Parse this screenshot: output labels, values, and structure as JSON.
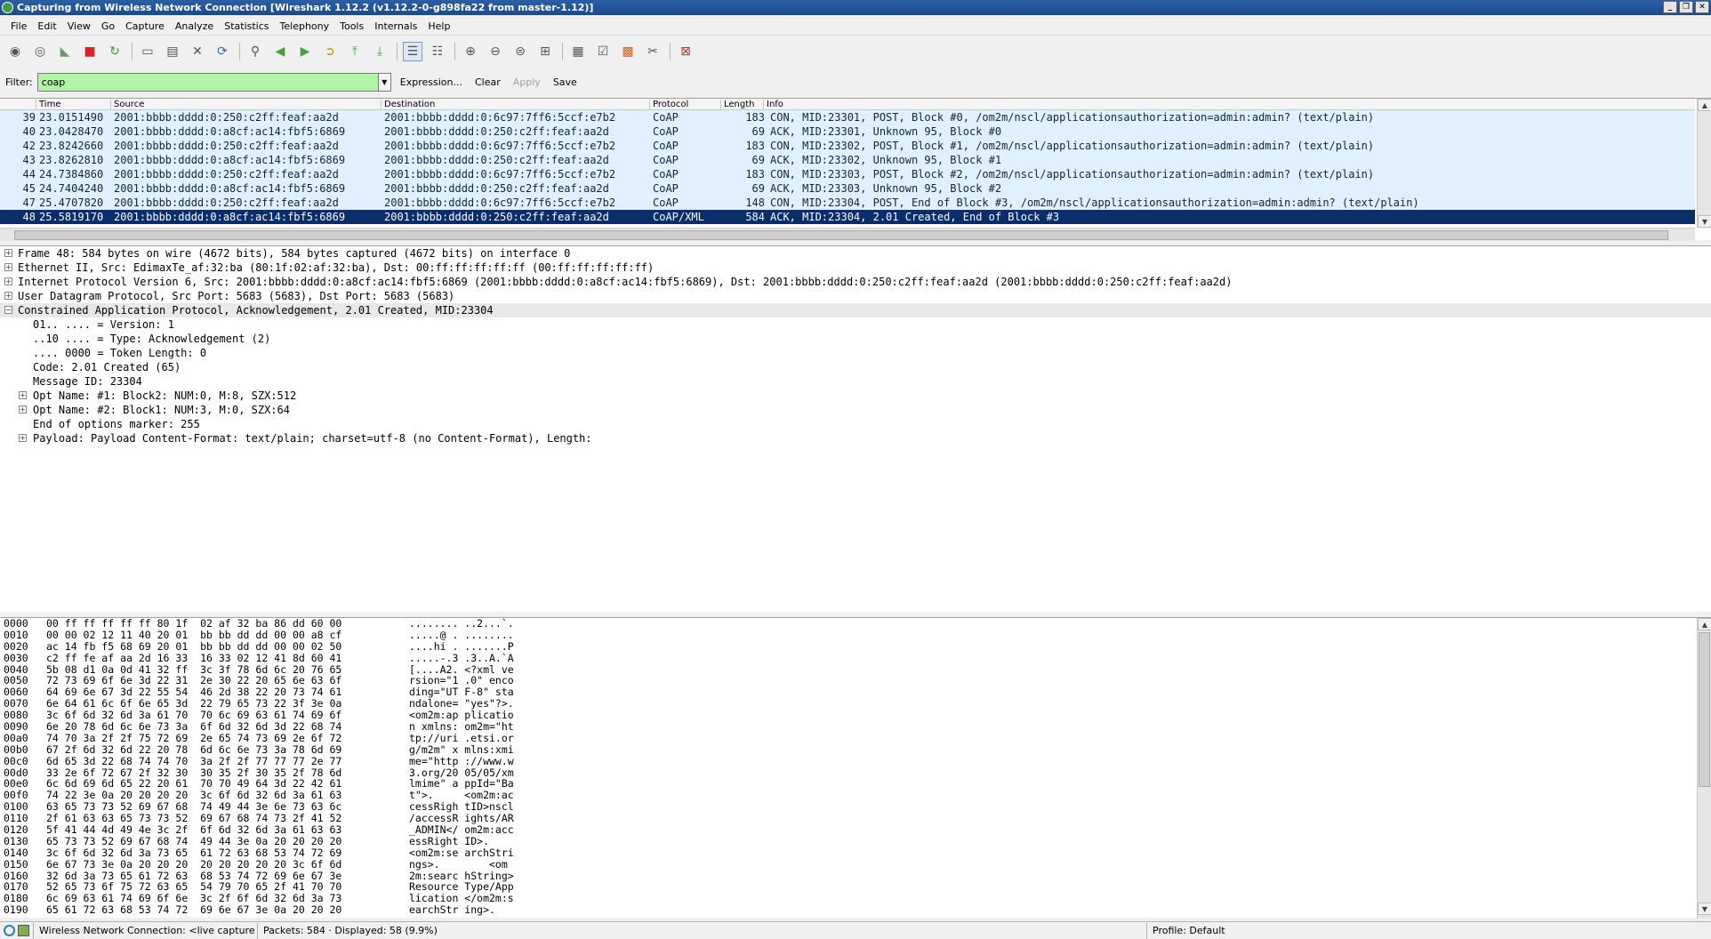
{
  "window": {
    "title": "Capturing from Wireless Network Connection   [Wireshark 1.12.2  (v1.12.2-0-g898fa22 from master-1.12)]",
    "buttons": [
      "_",
      "❐",
      "✕"
    ]
  },
  "menu": [
    "File",
    "Edit",
    "View",
    "Go",
    "Capture",
    "Analyze",
    "Statistics",
    "Telephony",
    "Tools",
    "Internals",
    "Help"
  ],
  "filter": {
    "label": "Filter:",
    "value": "coap",
    "expression": "Expression...",
    "clear": "Clear",
    "apply": "Apply",
    "save": "Save"
  },
  "packet_list": {
    "columns": [
      "Time",
      "Source",
      "Destination",
      "Protocol",
      "Length",
      "Info"
    ],
    "rows": [
      {
        "no": "39",
        "time": "23.0151490",
        "src": "2001:bbbb:dddd:0:250:c2ff:feaf:aa2d",
        "dst": "2001:bbbb:dddd:0:6c97:7ff6:5ccf:e7b2",
        "proto": "CoAP",
        "len": "183",
        "info": "CON, MID:23301, POST, Block #0, /om2m/nscl/applicationsauthorization=admin:admin? (text/plain)"
      },
      {
        "no": "40",
        "time": "23.0428470",
        "src": "2001:bbbb:dddd:0:a8cf:ac14:fbf5:6869",
        "dst": "2001:bbbb:dddd:0:250:c2ff:feaf:aa2d",
        "proto": "CoAP",
        "len": "69",
        "info": "ACK, MID:23301, Unknown 95, Block #0"
      },
      {
        "no": "42",
        "time": "23.8242660",
        "src": "2001:bbbb:dddd:0:250:c2ff:feaf:aa2d",
        "dst": "2001:bbbb:dddd:0:6c97:7ff6:5ccf:e7b2",
        "proto": "CoAP",
        "len": "183",
        "info": "CON, MID:23302, POST, Block #1, /om2m/nscl/applicationsauthorization=admin:admin? (text/plain)"
      },
      {
        "no": "43",
        "time": "23.8262810",
        "src": "2001:bbbb:dddd:0:a8cf:ac14:fbf5:6869",
        "dst": "2001:bbbb:dddd:0:250:c2ff:feaf:aa2d",
        "proto": "CoAP",
        "len": "69",
        "info": "ACK, MID:23302, Unknown 95, Block #1"
      },
      {
        "no": "44",
        "time": "24.7384860",
        "src": "2001:bbbb:dddd:0:250:c2ff:feaf:aa2d",
        "dst": "2001:bbbb:dddd:0:6c97:7ff6:5ccf:e7b2",
        "proto": "CoAP",
        "len": "183",
        "info": "CON, MID:23303, POST, Block #2, /om2m/nscl/applicationsauthorization=admin:admin? (text/plain)"
      },
      {
        "no": "45",
        "time": "24.7404240",
        "src": "2001:bbbb:dddd:0:a8cf:ac14:fbf5:6869",
        "dst": "2001:bbbb:dddd:0:250:c2ff:feaf:aa2d",
        "proto": "CoAP",
        "len": "69",
        "info": "ACK, MID:23303, Unknown 95, Block #2"
      },
      {
        "no": "47",
        "time": "25.4707820",
        "src": "2001:bbbb:dddd:0:250:c2ff:feaf:aa2d",
        "dst": "2001:bbbb:dddd:0:6c97:7ff6:5ccf:e7b2",
        "proto": "CoAP",
        "len": "148",
        "info": "CON, MID:23304, POST, End of Block #3, /om2m/nscl/applicationsauthorization=admin:admin? (text/plain)"
      },
      {
        "no": "48",
        "time": "25.5819170",
        "src": "2001:bbbb:dddd:0:a8cf:ac14:fbf5:6869",
        "dst": "2001:bbbb:dddd:0:250:c2ff:feaf:aa2d",
        "proto": "CoAP/XML",
        "len": "584",
        "info": "ACK, MID:23304, 2.01 Created, End of Block #3"
      }
    ]
  },
  "details": [
    {
      "text": "Frame 48: 584 bytes on wire (4672 bits), 584 bytes captured (4672 bits) on interface 0",
      "exp": "+"
    },
    {
      "text": "Ethernet II, Src: EdimaxTe_af:32:ba (80:1f:02:af:32:ba), Dst: 00:ff:ff:ff:ff:ff (00:ff:ff:ff:ff:ff)",
      "exp": "+"
    },
    {
      "text": "Internet Protocol Version 6, Src: 2001:bbbb:dddd:0:a8cf:ac14:fbf5:6869 (2001:bbbb:dddd:0:a8cf:ac14:fbf5:6869), Dst: 2001:bbbb:dddd:0:250:c2ff:feaf:aa2d (2001:bbbb:dddd:0:250:c2ff:feaf:aa2d)",
      "exp": "+"
    },
    {
      "text": "User Datagram Protocol, Src Port: 5683 (5683), Dst Port: 5683 (5683)",
      "exp": "+"
    },
    {
      "text": "Constrained Application Protocol, Acknowledgement, 2.01 Created, MID:23304",
      "exp": "−"
    },
    {
      "text": "01.. .... = Version: 1",
      "exp": ""
    },
    {
      "text": "..10 .... = Type: Acknowledgement (2)",
      "exp": ""
    },
    {
      "text": ".... 0000 = Token Length: 0",
      "exp": ""
    },
    {
      "text": "Code: 2.01 Created (65)",
      "exp": ""
    },
    {
      "text": "Message ID: 23304",
      "exp": ""
    },
    {
      "text": "Opt Name: #1: Block2: NUM:0, M:8, SZX:512",
      "exp": "+"
    },
    {
      "text": "Opt Name: #2: Block1: NUM:3, M:0, SZX:64",
      "exp": "+"
    },
    {
      "text": "End of options marker: 255",
      "exp": ""
    },
    {
      "text": "Payload: Payload Content-Format: text/plain; charset=utf-8 (no Content-Format), Length:",
      "exp": "+"
    }
  ],
  "hex": [
    {
      "off": "0000",
      "bytes": "00 ff ff ff ff ff 80 1f  02 af 32 ba 86 dd 60 00",
      "ascii": "........ ..2...`."
    },
    {
      "off": "0010",
      "bytes": "00 00 02 12 11 40 20 01  bb bb dd dd 00 00 a8 cf",
      "ascii": ".....@ . ........"
    },
    {
      "off": "0020",
      "bytes": "ac 14 fb f5 68 69 20 01  bb bb dd dd 00 00 02 50",
      "ascii": "....hi . .......P"
    },
    {
      "off": "0030",
      "bytes": "c2 ff fe af aa 2d 16 33  16 33 02 12 41 8d 60 41",
      "ascii": ".....-.3 .3..A.`A"
    },
    {
      "off": "0040",
      "bytes": "5b 08 d1 0a 0d 41 32 ff  3c 3f 78 6d 6c 20 76 65",
      "ascii": "[....A2. <?xml ve"
    },
    {
      "off": "0050",
      "bytes": "72 73 69 6f 6e 3d 22 31  2e 30 22 20 65 6e 63 6f",
      "ascii": "rsion=\"1 .0\" enco"
    },
    {
      "off": "0060",
      "bytes": "64 69 6e 67 3d 22 55 54  46 2d 38 22 20 73 74 61",
      "ascii": "ding=\"UT F-8\" sta"
    },
    {
      "off": "0070",
      "bytes": "6e 64 61 6c 6f 6e 65 3d  22 79 65 73 22 3f 3e 0a",
      "ascii": "ndalone= \"yes\"?>."
    },
    {
      "off": "0080",
      "bytes": "3c 6f 6d 32 6d 3a 61 70  70 6c 69 63 61 74 69 6f",
      "ascii": "<om2m:ap plicatio"
    },
    {
      "off": "0090",
      "bytes": "6e 20 78 6d 6c 6e 73 3a  6f 6d 32 6d 3d 22 68 74",
      "ascii": "n xmlns: om2m=\"ht"
    },
    {
      "off": "00a0",
      "bytes": "74 70 3a 2f 2f 75 72 69  2e 65 74 73 69 2e 6f 72",
      "ascii": "tp://uri .etsi.or"
    },
    {
      "off": "00b0",
      "bytes": "67 2f 6d 32 6d 22 20 78  6d 6c 6e 73 3a 78 6d 69",
      "ascii": "g/m2m\" x mlns:xmi"
    },
    {
      "off": "00c0",
      "bytes": "6d 65 3d 22 68 74 74 70  3a 2f 2f 77 77 77 2e 77",
      "ascii": "me=\"http ://www.w"
    },
    {
      "off": "00d0",
      "bytes": "33 2e 6f 72 67 2f 32 30  30 35 2f 30 35 2f 78 6d",
      "ascii": "3.org/20 05/05/xm"
    },
    {
      "off": "00e0",
      "bytes": "6c 6d 69 6d 65 22 20 61  70 70 49 64 3d 22 42 61",
      "ascii": "lmime\" a ppId=\"Ba"
    },
    {
      "off": "00f0",
      "bytes": "74 22 3e 0a 20 20 20 20  3c 6f 6d 32 6d 3a 61 63",
      "ascii": "t\">.     <om2m:ac"
    },
    {
      "off": "0100",
      "bytes": "63 65 73 73 52 69 67 68  74 49 44 3e 6e 73 63 6c",
      "ascii": "cessRigh tID>nscl"
    },
    {
      "off": "0110",
      "bytes": "2f 61 63 63 65 73 73 52  69 67 68 74 73 2f 41 52",
      "ascii": "/accessR ights/AR"
    },
    {
      "off": "0120",
      "bytes": "5f 41 44 4d 49 4e 3c 2f  6f 6d 32 6d 3a 61 63 63",
      "ascii": "_ADMIN</ om2m:acc"
    },
    {
      "off": "0130",
      "bytes": "65 73 73 52 69 67 68 74  49 44 3e 0a 20 20 20 20",
      "ascii": "essRight ID>."
    },
    {
      "off": "0140",
      "bytes": "3c 6f 6d 32 6d 3a 73 65  61 72 63 68 53 74 72 69",
      "ascii": "<om2m:se archStri"
    },
    {
      "off": "0150",
      "bytes": "6e 67 73 3e 0a 20 20 20  20 20 20 20 20 3c 6f 6d",
      "ascii": "ngs>.        <om"
    },
    {
      "off": "0160",
      "bytes": "32 6d 3a 73 65 61 72 63  68 53 74 72 69 6e 67 3e",
      "ascii": "2m:searc hString>"
    },
    {
      "off": "0170",
      "bytes": "52 65 73 6f 75 72 63 65  54 79 70 65 2f 41 70 70",
      "ascii": "Resource Type/App"
    },
    {
      "off": "0180",
      "bytes": "6c 69 63 61 74 69 6f 6e  3c 2f 6f 6d 32 6d 3a 73",
      "ascii": "lication </om2m:s"
    },
    {
      "off": "0190",
      "bytes": "65 61 72 63 68 53 74 72  69 6e 67 3e 0a 20 20 20",
      "ascii": "earchStr ing>."
    }
  ],
  "status": {
    "capture": "Wireless Network Connection: <live capture in pr...",
    "packets": "Packets: 584 · Displayed: 58 (9.9%)",
    "profile": "Profile: Default"
  },
  "toolbar_icons": [
    "interface-list-icon",
    "capture-options-icon",
    "start-capture-icon",
    "stop-capture-icon",
    "restart-capture-icon",
    "open-file-icon",
    "save-file-icon",
    "close-file-icon",
    "reload-icon",
    "find-packet-icon",
    "go-back-icon",
    "go-forward-icon",
    "go-to-packet-icon",
    "go-first-icon",
    "go-last-icon",
    "colorize-icon",
    "auto-scroll-icon",
    "zoom-in-icon",
    "zoom-out-icon",
    "normal-size-icon",
    "resize-columns-icon",
    "capture-filters-icon",
    "display-filters-icon",
    "coloring-rules-icon",
    "preferences-icon",
    "help-icon"
  ]
}
